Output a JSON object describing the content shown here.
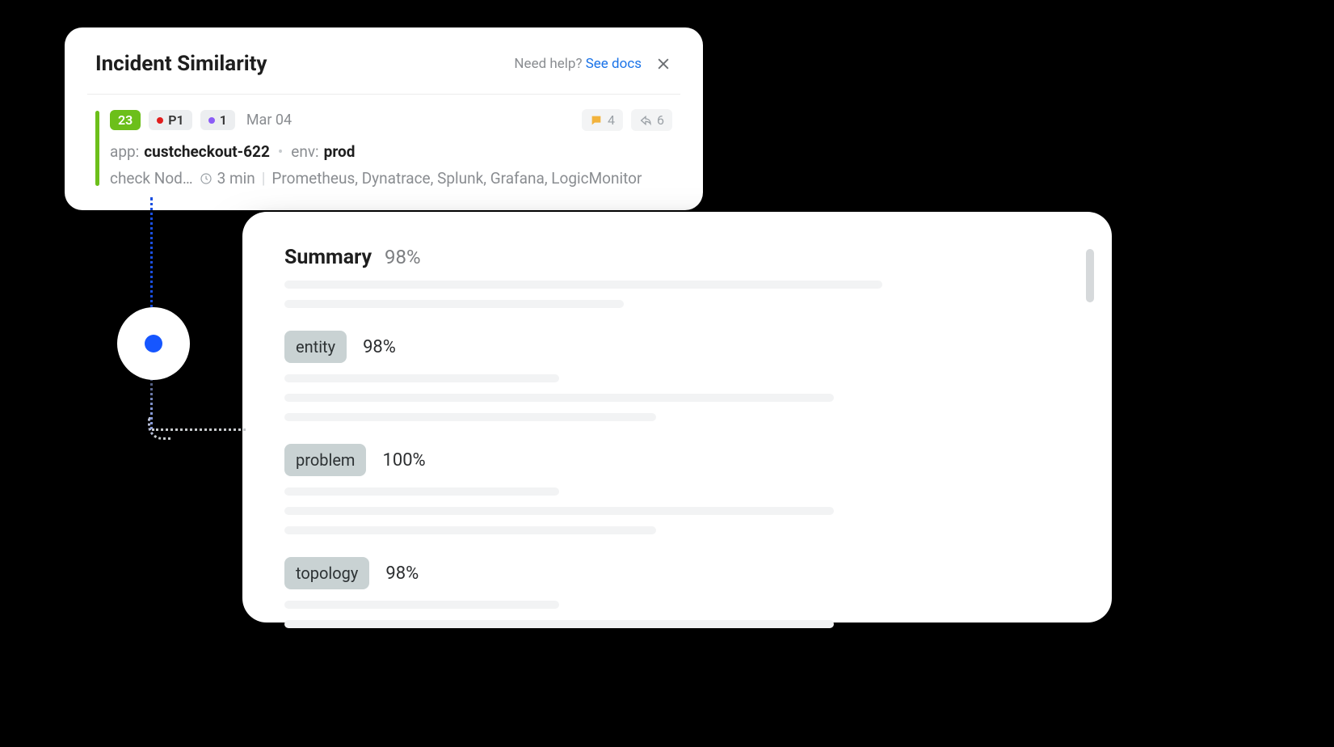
{
  "header": {
    "title": "Incident Similarity",
    "help_prefix": "Need help? ",
    "see_docs": "See docs"
  },
  "incident": {
    "count": "23",
    "priority_label": "P1",
    "secondary_count": "1",
    "date": "Mar 04",
    "comments_count": "4",
    "shares_count": "6",
    "app_key": "app:",
    "app_value": "custcheckout-622",
    "env_key": "env:",
    "env_value": "prod",
    "check_text": "check Nod…",
    "age": "3 min",
    "sources": "Prometheus, Dynatrace, Splunk, Grafana, LogicMonitor"
  },
  "summary": {
    "title": "Summary",
    "percent": "98%",
    "items": [
      {
        "label": "entity",
        "percent": "98%"
      },
      {
        "label": "problem",
        "percent": "100%"
      },
      {
        "label": "topology",
        "percent": "98%"
      }
    ]
  },
  "colors": {
    "accent_green": "#6cbf1a",
    "accent_blue": "#1a73e8",
    "node_blue": "#1656ff",
    "priority_red": "#e11d1d",
    "secondary_purple": "#8b5cf6"
  }
}
